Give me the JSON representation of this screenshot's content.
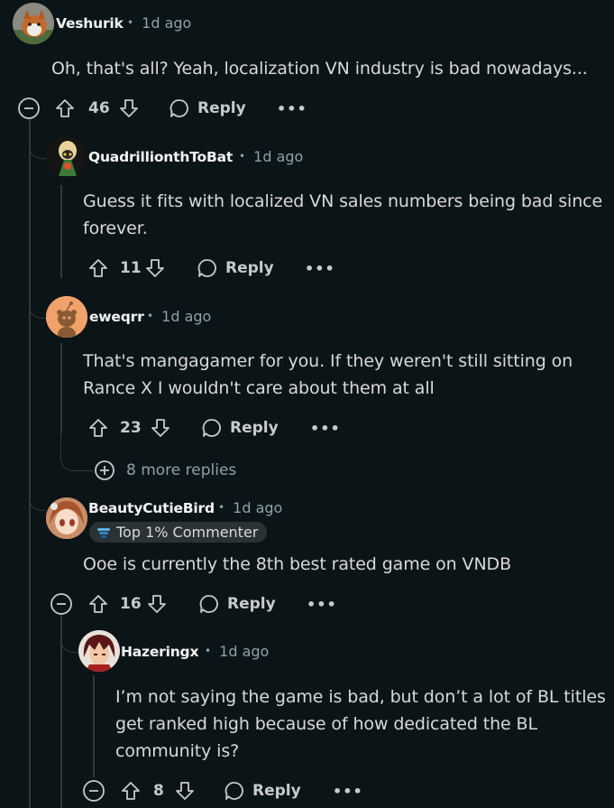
{
  "comments": [
    {
      "username": "Veshurik",
      "time": "1d ago",
      "body_lines": [
        "Oh, that's all? Yeah, localization VN industry is bad nowadays..."
      ],
      "score": "46",
      "reply_label": "Reply"
    },
    {
      "username": "QuadrillionthToBat",
      "time": "1d ago",
      "body_lines": [
        "Guess it fits with localized VN sales numbers being bad since",
        "forever."
      ],
      "score": "11",
      "reply_label": "Reply"
    },
    {
      "username": "eweqrr",
      "time": "1d ago",
      "body_lines": [
        "That's mangagamer for you. If they weren't still sitting on",
        "Rance X I wouldn't care about them at all"
      ],
      "score": "23",
      "reply_label": "Reply",
      "more_replies": "8 more replies"
    },
    {
      "username": "BeautyCutieBird",
      "time": "1d ago",
      "flair": "Top 1% Commenter",
      "body_lines": [
        "Ooe is currently the 8th best rated game on VNDB"
      ],
      "score": "16",
      "reply_label": "Reply"
    },
    {
      "username": "Hazeringx",
      "time": "1d ago",
      "body_lines": [
        "I’m not saying the game is bad, but don’t a lot of BL titles",
        "get ranked high because of how dedicated the BL",
        "community is?"
      ],
      "score": "8",
      "reply_label": "Reply"
    }
  ],
  "separator": "•",
  "more_label": "•••",
  "icons": {
    "collapse": "minus-circle-icon",
    "upvote": "upvote-arrow-icon",
    "downvote": "downvote-arrow-icon",
    "reply": "speech-bubble-icon",
    "more": "ellipsis-icon",
    "expand": "plus-circle-icon",
    "flair": "flair-badge-icon"
  },
  "colors": {
    "background": "#0b1416",
    "thread_line": "#33393b",
    "username": "#f2f4f5",
    "meta": "#8ba2ad",
    "body_text": "#d7dadc",
    "flair_bg": "#2a3236"
  }
}
